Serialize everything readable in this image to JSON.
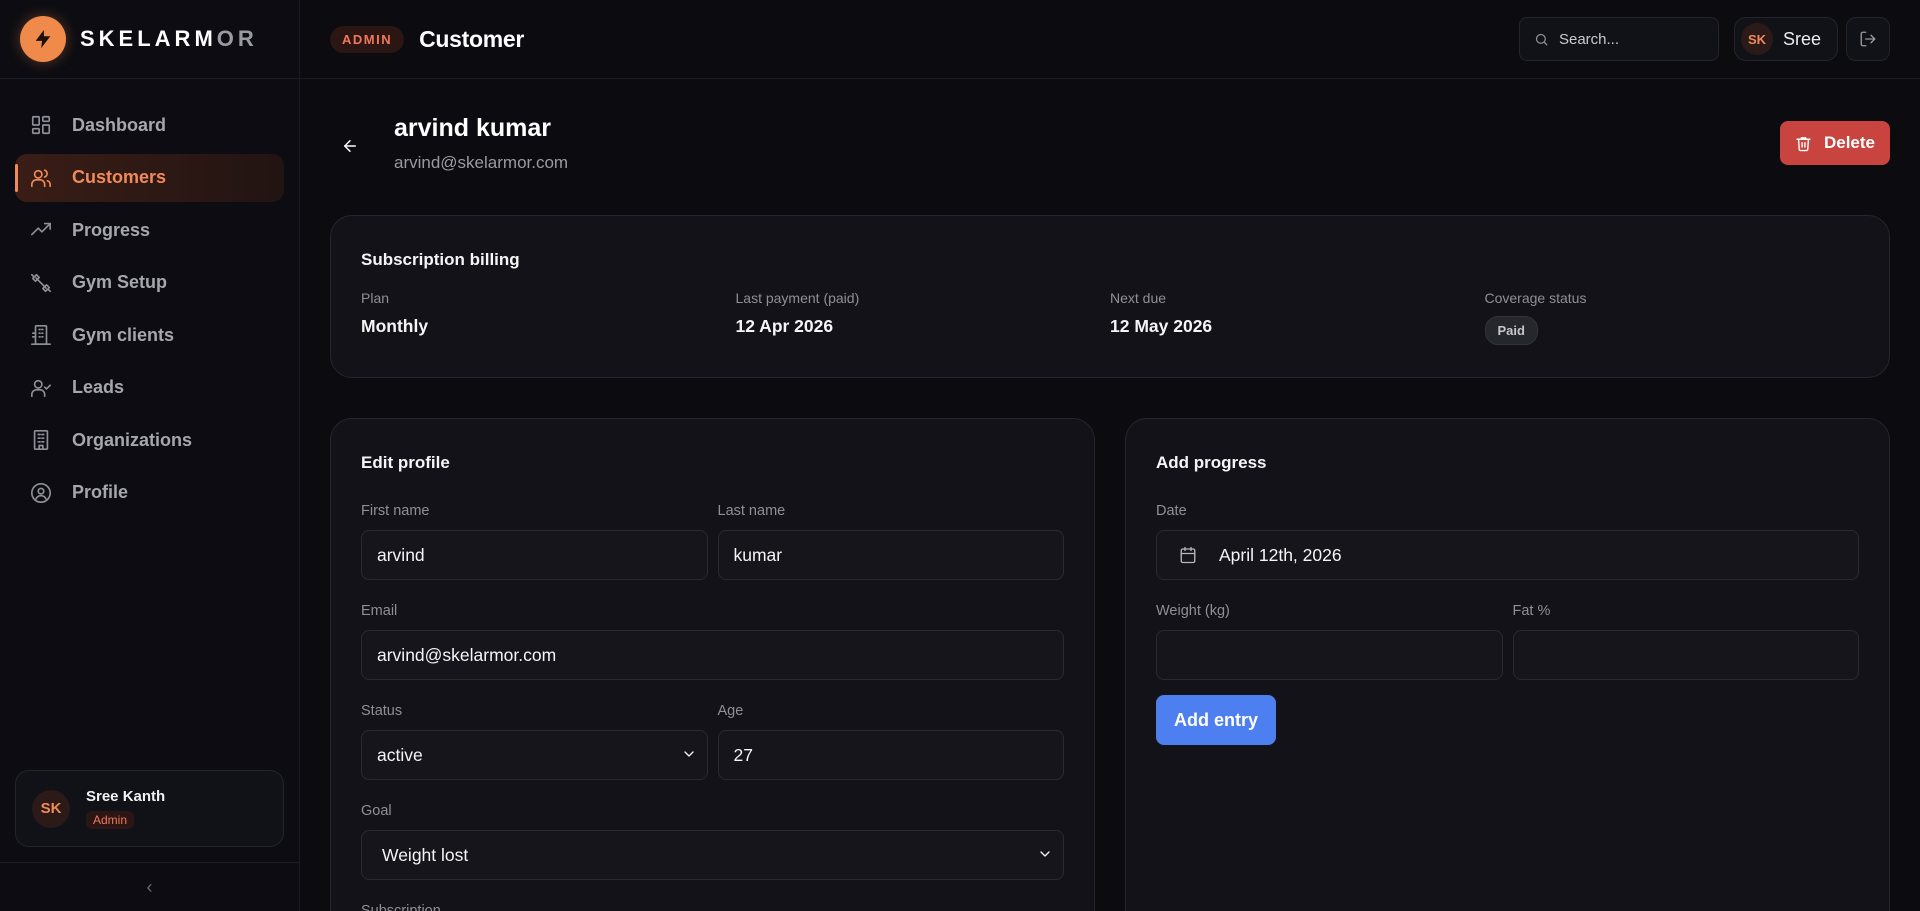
{
  "brand": {
    "name_main": "SKELARM",
    "name_dim": "OR"
  },
  "sidebar": {
    "items": [
      {
        "label": "Dashboard",
        "icon": "dashboard-icon"
      },
      {
        "label": "Customers",
        "icon": "users-icon"
      },
      {
        "label": "Progress",
        "icon": "trending-up-icon"
      },
      {
        "label": "Gym Setup",
        "icon": "dumbbell-icon"
      },
      {
        "label": "Gym clients",
        "icon": "building-icon"
      },
      {
        "label": "Leads",
        "icon": "user-check-icon"
      },
      {
        "label": "Organizations",
        "icon": "office-building-icon"
      },
      {
        "label": "Profile",
        "icon": "user-circle-icon"
      }
    ],
    "active_index": 1,
    "user": {
      "initials": "SK",
      "name": "Sree Kanth",
      "role": "Admin"
    },
    "collapse_glyph": "‹"
  },
  "topbar": {
    "badge": "ADMIN",
    "title": "Customer",
    "search_placeholder": "Search...",
    "user_initials": "SK",
    "user_name": "Sree"
  },
  "customer": {
    "name": "arvind kumar",
    "email": "arvind@skelarmor.com",
    "delete_label": "Delete"
  },
  "billing": {
    "title": "Subscription billing",
    "plan_label": "Plan",
    "plan_value": "Monthly",
    "last_payment_label": "Last payment (paid)",
    "last_payment_value": "12 Apr 2026",
    "next_due_label": "Next due",
    "next_due_value": "12 May 2026",
    "coverage_label": "Coverage status",
    "coverage_value": "Paid"
  },
  "profile_form": {
    "title": "Edit profile",
    "first_name_label": "First name",
    "first_name_value": "arvind",
    "last_name_label": "Last name",
    "last_name_value": "kumar",
    "email_label": "Email",
    "email_value": "arvind@skelarmor.com",
    "status_label": "Status",
    "status_value": "active",
    "age_label": "Age",
    "age_value": "27",
    "goal_label": "Goal",
    "goal_value": "Weight lost",
    "subscription_label": "Subscription"
  },
  "progress_form": {
    "title": "Add progress",
    "date_label": "Date",
    "date_value": "April 12th, 2026",
    "weight_label": "Weight (kg)",
    "weight_value": "",
    "fat_label": "Fat %",
    "fat_value": "",
    "add_label": "Add entry"
  },
  "colors": {
    "accent": "#f08a5b",
    "danger": "#c9443f",
    "primary": "#4d7ff0",
    "background": "#0b0b10"
  }
}
